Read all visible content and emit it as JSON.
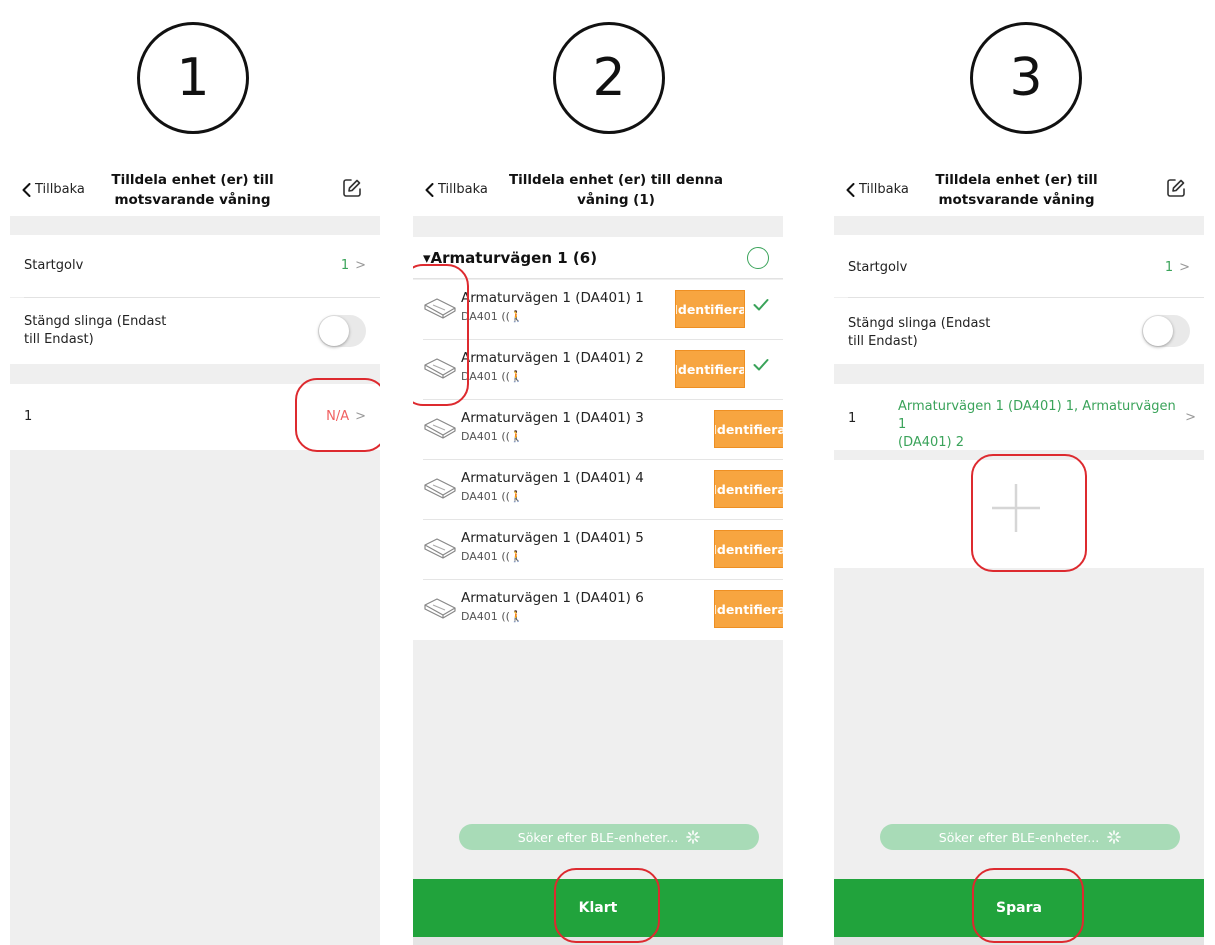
{
  "steps": [
    "1",
    "2",
    "3"
  ],
  "colors": {
    "accent_green": "#21a33c",
    "status_green": "#3aa35a",
    "orange": "#f7a540",
    "callout_red": "#dd2a2f",
    "na_red": "#f06060"
  },
  "panel1": {
    "back_label": "Tillbaka",
    "title_line1": "Tilldela enhet (er) till",
    "title_line2": "motsvarande våning",
    "start_floor_label": "Startgolv",
    "start_floor_value": "1",
    "closed_loop_label_line1": "Stängd slinga (Endast",
    "closed_loop_label_line2": "till Endast)",
    "closed_loop_on": false,
    "floor_row_label": "1",
    "floor_row_value": "N/A"
  },
  "panel2": {
    "back_label": "Tillbaka",
    "title_line1": "Tilldela enhet (er) till denna",
    "title_line2": "våning (1)",
    "group_name": "▾Armaturvägen 1 (6)",
    "identify_label": "Identifiera",
    "devices": [
      {
        "name": "Armaturvägen 1 (DA401) 1",
        "model": "DA401",
        "selected": true
      },
      {
        "name": "Armaturvägen 1 (DA401) 2",
        "model": "DA401",
        "selected": true
      },
      {
        "name": "Armaturvägen 1 (DA401) 3",
        "model": "DA401",
        "selected": false
      },
      {
        "name": "Armaturvägen 1 (DA401) 4",
        "model": "DA401",
        "selected": false
      },
      {
        "name": "Armaturvägen 1 (DA401) 5",
        "model": "DA401",
        "selected": false
      },
      {
        "name": "Armaturvägen 1 (DA401) 6",
        "model": "DA401",
        "selected": false
      }
    ],
    "ble_status": "Söker efter BLE-enheter...",
    "done_button": "Klart"
  },
  "panel3": {
    "back_label": "Tillbaka",
    "title_line1": "Tilldela enhet (er) till",
    "title_line2": "motsvarande våning",
    "start_floor_label": "Startgolv",
    "start_floor_value": "1",
    "closed_loop_label_line1": "Stängd slinga (Endast",
    "closed_loop_label_line2": "till Endast)",
    "closed_loop_on": false,
    "floor_row_label": "1",
    "floor_row_value_line1": "Armaturvägen 1 (DA401) 1, Armaturvägen 1",
    "floor_row_value_line2": "(DA401) 2",
    "ble_status": "Söker efter BLE-enheter...",
    "save_button": "Spara"
  }
}
